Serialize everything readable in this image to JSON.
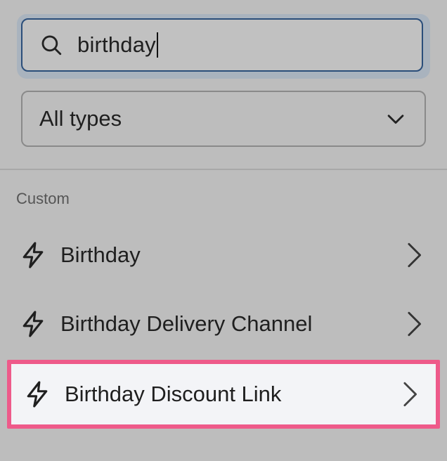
{
  "search": {
    "value": "birthday",
    "icon": "search-icon"
  },
  "type_filter": {
    "selected": "All types",
    "icon": "chevron-down-icon"
  },
  "section": {
    "label": "Custom"
  },
  "items": [
    {
      "label": "Birthday",
      "icon": "lightning-icon"
    },
    {
      "label": "Birthday Delivery Channel",
      "icon": "lightning-icon"
    },
    {
      "label": "Birthday Discount Link",
      "icon": "lightning-icon",
      "highlighted": true
    }
  ],
  "colors": {
    "highlight_border": "#ee5a8a",
    "focus_border": "#2b4e7a",
    "background": "#bdbdbd"
  }
}
